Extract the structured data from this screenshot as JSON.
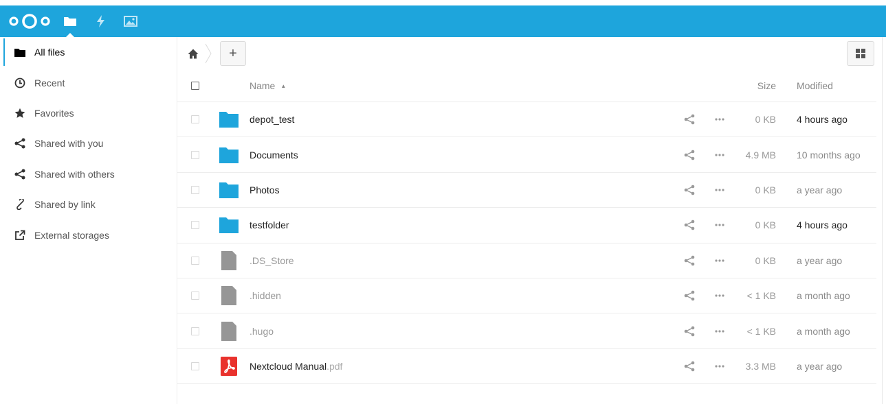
{
  "colors": {
    "accent": "#1ea5dc",
    "folder": "#1ea5dc",
    "file_gray": "#969696",
    "pdf_red": "#e9322d"
  },
  "header": {
    "apps": [
      {
        "name": "files",
        "icon": "folder-icon"
      },
      {
        "name": "activity",
        "icon": "lightning-icon"
      },
      {
        "name": "gallery",
        "icon": "image-icon"
      }
    ]
  },
  "sidebar": {
    "items": [
      {
        "label": "All files",
        "icon": "folder-icon",
        "active": true
      },
      {
        "label": "Recent",
        "icon": "clock-icon"
      },
      {
        "label": "Favorites",
        "icon": "star-icon"
      },
      {
        "label": "Shared with you",
        "icon": "share-icon"
      },
      {
        "label": "Shared with others",
        "icon": "share-icon"
      },
      {
        "label": "Shared by link",
        "icon": "link-icon"
      },
      {
        "label": "External storages",
        "icon": "external-link-icon"
      }
    ]
  },
  "controls": {
    "add_label": "+"
  },
  "table": {
    "headers": {
      "name": "Name",
      "size": "Size",
      "modified": "Modified"
    },
    "rows": [
      {
        "name": "depot_test",
        "ext": "",
        "type": "folder",
        "size": "0 KB",
        "modified": "4 hours ago",
        "modified_color": "#222222"
      },
      {
        "name": "Documents",
        "ext": "",
        "type": "folder",
        "size": "4.9 MB",
        "modified": "10 months ago",
        "modified_color": "#8a8a8a"
      },
      {
        "name": "Photos",
        "ext": "",
        "type": "folder",
        "size": "0 KB",
        "modified": "a year ago",
        "modified_color": "#8a8a8a"
      },
      {
        "name": "testfolder",
        "ext": "",
        "type": "folder",
        "size": "0 KB",
        "modified": "4 hours ago",
        "modified_color": "#222222"
      },
      {
        "name": ".DS_Store",
        "ext": "",
        "type": "file",
        "hidden": true,
        "size": "0 KB",
        "modified": "a year ago",
        "modified_color": "#8a8a8a"
      },
      {
        "name": ".hidden",
        "ext": "",
        "type": "file",
        "hidden": true,
        "size": "< 1 KB",
        "modified": "a month ago",
        "modified_color": "#8a8a8a"
      },
      {
        "name": ".hugo",
        "ext": "",
        "type": "file",
        "hidden": true,
        "size": "< 1 KB",
        "modified": "a month ago",
        "modified_color": "#8a8a8a"
      },
      {
        "name": "Nextcloud Manual",
        "ext": ".pdf",
        "type": "pdf",
        "size": "3.3 MB",
        "modified": "a year ago",
        "modified_color": "#8a8a8a"
      }
    ]
  }
}
